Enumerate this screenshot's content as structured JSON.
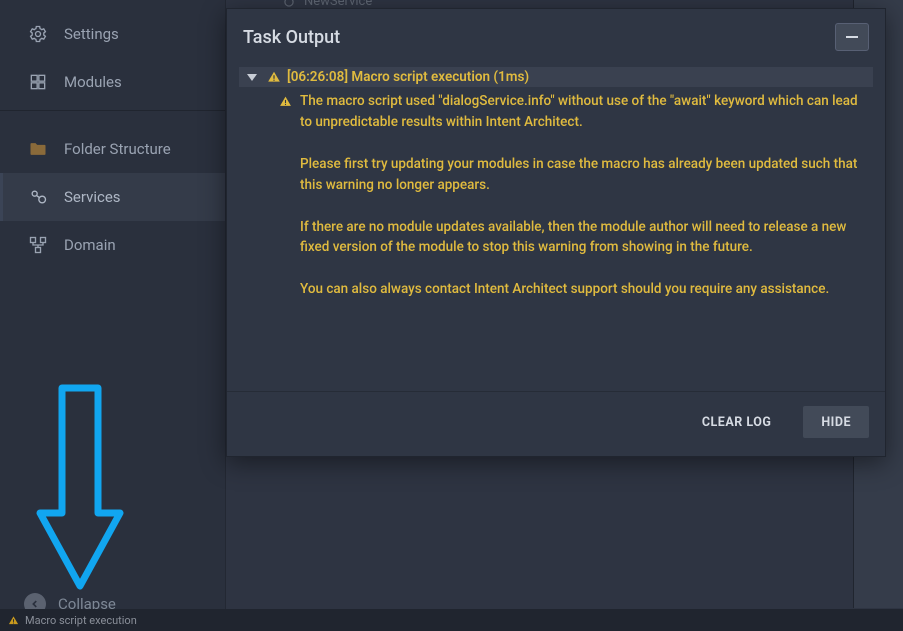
{
  "sidebar": {
    "items": [
      {
        "label": "Settings",
        "icon": "gear-icon",
        "active": false
      },
      {
        "label": "Modules",
        "icon": "modules-icon",
        "active": false
      },
      {
        "label": "Folder Structure",
        "icon": "folder-icon",
        "active": false
      },
      {
        "label": "Services",
        "icon": "services-icon",
        "active": true
      },
      {
        "label": "Domain",
        "icon": "domain-icon",
        "active": false
      }
    ],
    "collapse_label": "Collapse"
  },
  "tree_ghost": "NewService",
  "dialog": {
    "title": "Task Output",
    "log_header": "[06:26:08] Macro script execution (1ms)",
    "message": "The macro script used \"dialogService.info\" without use of the \"await\" keyword which can lead to unpredictable results within Intent Architect.\n\nPlease first try updating your modules in case the macro has already been updated such that this warning no longer appears.\n\nIf there are no module updates available, then the module author will need to release a new fixed version of the module to stop this warning from showing in the future.\n\nYou can also always contact Intent Architect support should you require any assistance.",
    "button_clear": "CLEAR LOG",
    "button_hide": "HIDE"
  },
  "statusbar": {
    "text": "Macro script execution"
  },
  "colors": {
    "warning": "#e0bb3f"
  }
}
